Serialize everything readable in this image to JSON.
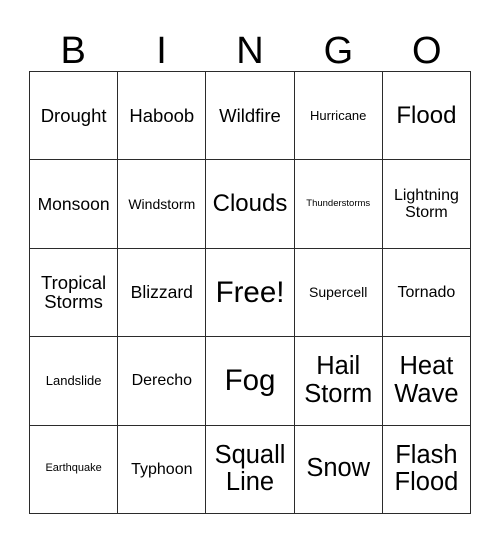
{
  "card": {
    "title": "BINGO",
    "headers": [
      "B",
      "I",
      "N",
      "G",
      "O"
    ],
    "grid": [
      [
        {
          "label": "Drought",
          "size": "fs-l"
        },
        {
          "label": "Haboob",
          "size": "fs-l"
        },
        {
          "label": "Wildfire",
          "size": "fs-l"
        },
        {
          "label": "Hurricane",
          "size": "fs-s"
        },
        {
          "label": "Flood",
          "size": "fs-xxl"
        }
      ],
      [
        {
          "label": "Monsoon",
          "size": "fs-ml"
        },
        {
          "label": "Windstorm",
          "size": "fs-sm"
        },
        {
          "label": "Clouds",
          "size": "fs-xxl"
        },
        {
          "label": "Thunderstorms",
          "size": "fs-xxs"
        },
        {
          "label": "Lightning Storm",
          "size": "fs-m"
        }
      ],
      [
        {
          "label": "Tropical Storms",
          "size": "fs-l"
        },
        {
          "label": "Blizzard",
          "size": "fs-ml"
        },
        {
          "label": "Free!",
          "size": "fs-hh"
        },
        {
          "label": "Supercell",
          "size": "fs-sm"
        },
        {
          "label": "Tornado",
          "size": "fs-m"
        }
      ],
      [
        {
          "label": "Landslide",
          "size": "fs-s"
        },
        {
          "label": "Derecho",
          "size": "fs-m"
        },
        {
          "label": "Fog",
          "size": "fs-hh"
        },
        {
          "label": "Hail Storm",
          "size": "fs-h"
        },
        {
          "label": "Heat Wave",
          "size": "fs-h"
        }
      ],
      [
        {
          "label": "Earthquake",
          "size": "fs-xs"
        },
        {
          "label": "Typhoon",
          "size": "fs-m"
        },
        {
          "label": "Squall Line",
          "size": "fs-h"
        },
        {
          "label": "Snow",
          "size": "fs-h"
        },
        {
          "label": "Flash Flood",
          "size": "fs-h"
        }
      ]
    ],
    "colors": {
      "background": "#ffffff",
      "text": "#000000",
      "border": "#2b2b2b"
    }
  }
}
